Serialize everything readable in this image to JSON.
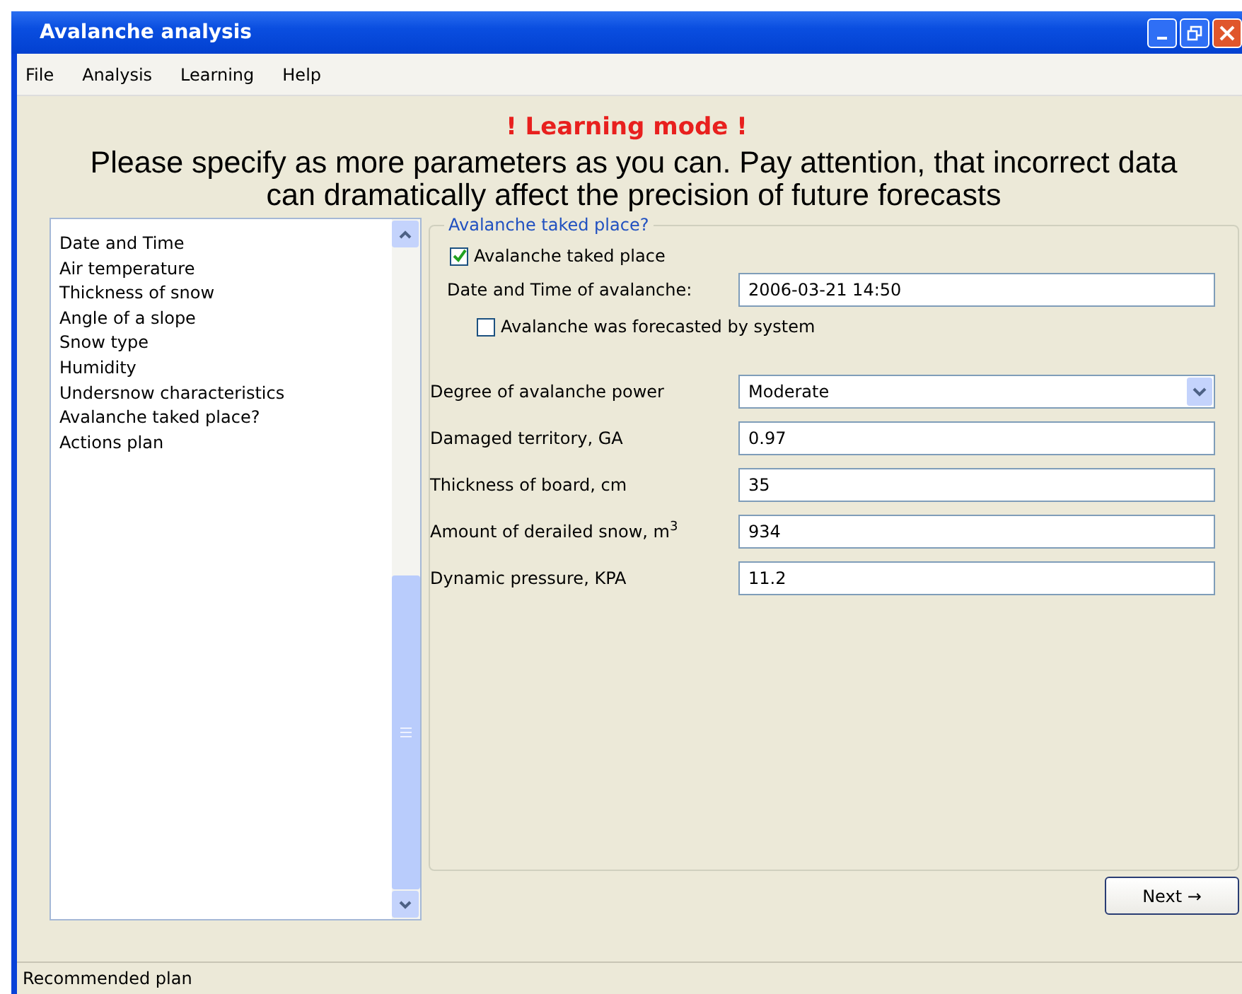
{
  "window": {
    "title": "Avalanche analysis"
  },
  "menu": [
    "File",
    "Analysis",
    "Learning",
    "Help"
  ],
  "mode_banner": "! Learning mode !",
  "instructions": "Please specify as more parameters as you can. Pay attention, that incorrect data can dramatically affect the precision of future forecasts",
  "sections": [
    {
      "label": "Date and Time"
    },
    {
      "label": "Air temperature"
    },
    {
      "label": "Thickness of snow"
    },
    {
      "label": "Angle of a slope"
    },
    {
      "label": "Snow type"
    },
    {
      "label": "Humidity"
    },
    {
      "label": "Undersnow characteristics"
    },
    {
      "label": "Avalanche taked place?"
    },
    {
      "label": "Actions plan"
    }
  ],
  "group": {
    "title": "Avalanche taked place?",
    "taked_place": {
      "label": "Avalanche taked place",
      "checked": true
    },
    "date_time": {
      "label": "Date and Time of avalanche:",
      "value": "2006-03-21 14:50"
    },
    "forecasted": {
      "label": "Avalanche was forecasted by system",
      "checked": false
    },
    "fields": [
      {
        "kind": "select",
        "label": "Degree of avalanche power",
        "value": "Moderate"
      },
      {
        "kind": "text",
        "label": "Damaged territory, GA",
        "value": "0.97"
      },
      {
        "kind": "text",
        "label": "Thickness of board, cm",
        "value": "35"
      },
      {
        "kind": "text",
        "label": "Amount of derailed snow, m$^{3}$",
        "value": "934"
      },
      {
        "kind": "text",
        "label": "Dynamic pressure, KPA",
        "value": "11.2"
      }
    ]
  },
  "next_button": "Next →",
  "status_bar": "Recommended plan"
}
